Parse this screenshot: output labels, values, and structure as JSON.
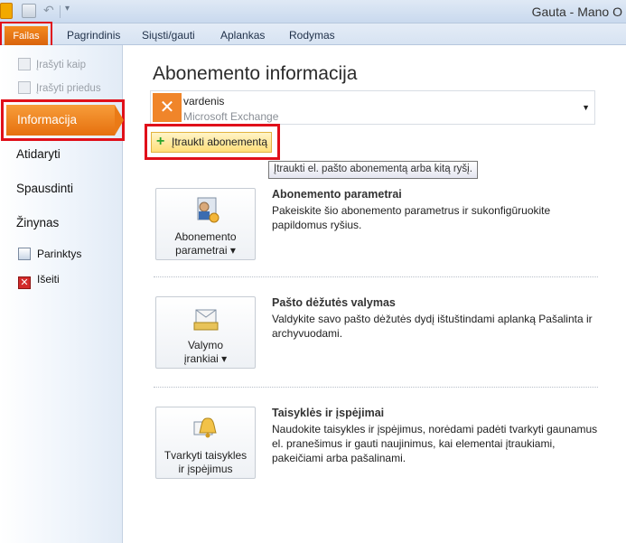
{
  "window": {
    "title": "Gauta - Mano O"
  },
  "ribbon": {
    "tabs": [
      "Failas",
      "Pagrindinis",
      "Siųsti/gauti",
      "Aplankas",
      "Rodymas"
    ]
  },
  "leftnav": {
    "small_items": [
      "Įrašyti kaip",
      "Įrašyti priedus"
    ],
    "active": "Informacija",
    "items": [
      "Atidaryti",
      "Spausdinti",
      "Žinynas"
    ],
    "options": "Parinktys",
    "exit": "Išeiti"
  },
  "main": {
    "title": "Abonemento informacija",
    "account": {
      "name": "vardenis",
      "type": "Microsoft Exchange"
    },
    "add_button": "Įtraukti abonementą",
    "tooltip": "Įtraukti el. pašto abonementą arba kitą ryšį.",
    "sections": [
      {
        "button_line1": "Abonemento",
        "button_line2": "parametrai ▾",
        "title": "Abonemento parametrai",
        "desc": "Pakeiskite šio abonemento parametrus ir sukonfigūruokite papildomus ryšius."
      },
      {
        "button_line1": "Valymo",
        "button_line2": "įrankiai ▾",
        "title": "Pašto dėžutės valymas",
        "desc": "Valdykite savo pašto dėžutės dydį ištuštindami aplanką Pašalinta ir archyvuodami."
      },
      {
        "button_line1": "Tvarkyti taisykles",
        "button_line2": "ir įspėjimus",
        "title": "Taisyklės ir įspėjimai",
        "desc": "Naudokite taisykles ir įspėjimus, norėdami padėti tvarkyti gaunamus el. pranešimus ir gauti naujinimus, kai elementai įtraukiami, pakeičiami arba pašalinami."
      }
    ]
  },
  "colors": {
    "highlight_border": "#e0101a",
    "file_tab": "#e6700e",
    "active_nav": "#ea7a16"
  }
}
